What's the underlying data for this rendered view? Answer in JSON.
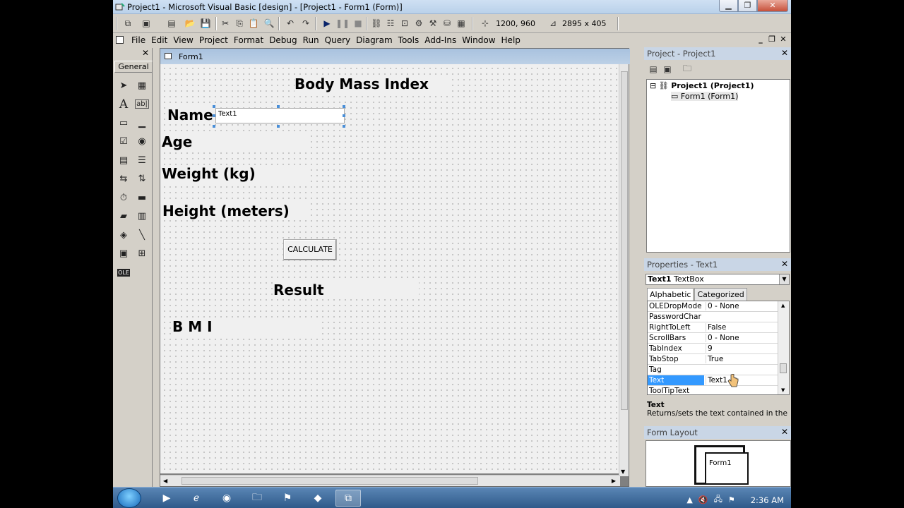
{
  "window": {
    "title": "Project1 - Microsoft Visual Basic [design] - [Project1 - Form1 (Form)]"
  },
  "toolbar": {
    "position_readout": "1200, 960",
    "size_readout": "2895 x 405"
  },
  "menu": [
    "File",
    "Edit",
    "View",
    "Project",
    "Format",
    "Debug",
    "Run",
    "Query",
    "Diagram",
    "Tools",
    "Add-Ins",
    "Window",
    "Help"
  ],
  "toolbox": {
    "tab_label": "General",
    "tools": [
      {
        "name": "pointer-tool",
        "glyph": "➤"
      },
      {
        "name": "picturebox-tool",
        "glyph": "▦"
      },
      {
        "name": "label-tool",
        "glyph": "A"
      },
      {
        "name": "textbox-tool",
        "glyph": "ab|"
      },
      {
        "name": "frame-tool",
        "glyph": "▭"
      },
      {
        "name": "commandbutton-tool",
        "glyph": "▁"
      },
      {
        "name": "checkbox-tool",
        "glyph": "☑"
      },
      {
        "name": "optionbutton-tool",
        "glyph": "◉"
      },
      {
        "name": "combobox-tool",
        "glyph": "▤"
      },
      {
        "name": "listbox-tool",
        "glyph": "☰"
      },
      {
        "name": "hscrollbar-tool",
        "glyph": "⇆"
      },
      {
        "name": "vscrollbar-tool",
        "glyph": "⇅"
      },
      {
        "name": "timer-tool",
        "glyph": "⏱"
      },
      {
        "name": "drivelistbox-tool",
        "glyph": "▬"
      },
      {
        "name": "dirlistbox-tool",
        "glyph": "▰"
      },
      {
        "name": "filelistbox-tool",
        "glyph": "▥"
      },
      {
        "name": "shape-tool",
        "glyph": "◈"
      },
      {
        "name": "line-tool",
        "glyph": "╲"
      },
      {
        "name": "image-tool",
        "glyph": "▣"
      },
      {
        "name": "data-tool",
        "glyph": "⊞"
      },
      {
        "name": "ole-tool",
        "glyph": "OLE"
      }
    ]
  },
  "form": {
    "caption": "Form1",
    "labels": {
      "title": "Body Mass Index",
      "name": "Name",
      "age": "Age",
      "weight": "Weight (kg)",
      "height": "Height (meters)",
      "result": "Result",
      "bmi": "B M I"
    },
    "textbox": "Text1",
    "button": "CALCULATE"
  },
  "project_panel": {
    "title": "Project - Project1",
    "tree_root": "Project1 (Project1)",
    "tree_child": "Form1 (Form1)"
  },
  "properties_panel": {
    "title": "Properties - Text1",
    "object_name": "Text1",
    "object_type": "TextBox",
    "tabs": [
      "Alphabetic",
      "Categorized"
    ],
    "rows": [
      {
        "key": "OLEDropMode",
        "value": "0 - None"
      },
      {
        "key": "PasswordChar",
        "value": ""
      },
      {
        "key": "RightToLeft",
        "value": "False"
      },
      {
        "key": "ScrollBars",
        "value": "0 - None"
      },
      {
        "key": "TabIndex",
        "value": "9"
      },
      {
        "key": "TabStop",
        "value": "True"
      },
      {
        "key": "Tag",
        "value": ""
      },
      {
        "key": "Text",
        "value": "Text1"
      },
      {
        "key": "ToolTipText",
        "value": ""
      }
    ],
    "description_title": "Text",
    "description_text": "Returns/sets the text contained in the"
  },
  "layout_panel": {
    "title": "Form Layout",
    "mini_form": "Form1"
  },
  "taskbar": {
    "clock": "2:36 AM"
  }
}
